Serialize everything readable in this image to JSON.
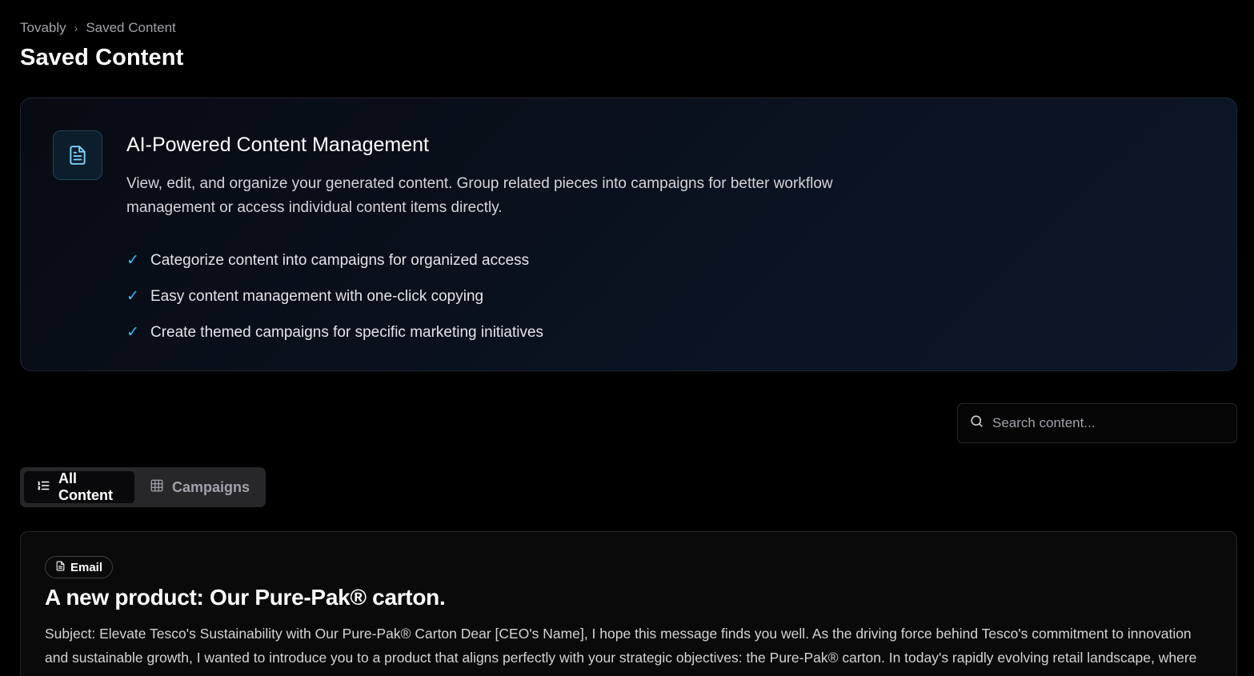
{
  "breadcrumb": {
    "root": "Tovably",
    "separator": "›",
    "current": "Saved Content"
  },
  "page_title": "Saved Content",
  "info_card": {
    "icon": "file-text-icon",
    "title": "AI-Powered Content Management",
    "description": "View, edit, and organize your generated content. Group related pieces into campaigns for better workflow management or access individual content items directly.",
    "check_glyph": "✓",
    "features": [
      "Categorize content into campaigns for organized access",
      "Easy content management with one-click copying",
      "Create themed campaigns for specific marketing initiatives"
    ]
  },
  "search": {
    "placeholder": "Search content...",
    "icon": "search-icon"
  },
  "tabs": [
    {
      "label": "All Content",
      "icon": "list-icon",
      "active": true
    },
    {
      "label": "Campaigns",
      "icon": "grid-icon",
      "active": false
    }
  ],
  "content_items": [
    {
      "badge": "Email",
      "badge_icon": "file-icon",
      "title": "A new product: Our Pure-Pak® carton.",
      "body": "Subject: Elevate Tesco's Sustainability with Our Pure-Pak® Carton Dear [CEO's Name], I hope this message finds you well. As the driving force behind Tesco's commitment to innovation and sustainable growth, I wanted to introduce you to a product that aligns perfectly with your strategic objectives: the Pure-Pak® carton. In today's rapidly evolving retail landscape, where consumers demand fresh options as well as responsible packaging, we offer a solution which meets these needs and aligns with your sustainability commitments."
    }
  ],
  "colors": {
    "accent": "#38bdf8",
    "background": "#000000",
    "card": "#0b1220"
  }
}
